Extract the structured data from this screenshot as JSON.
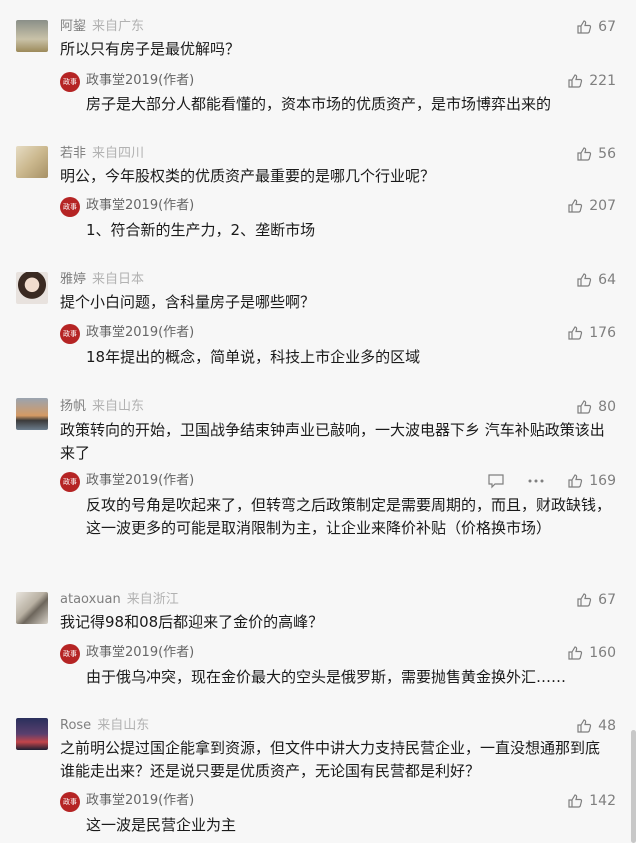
{
  "comments": [
    {
      "user": "阿鋆",
      "from": "来自广东",
      "likes": "67",
      "text": "所以只有房子是最优解吗？",
      "reply": {
        "author": "政事堂2019(作者)",
        "likes": "221",
        "text": "房子是大部分人都能看懂的，资本市场的优质资产，是市场博弈出来的"
      }
    },
    {
      "user": "若非",
      "from": "来自四川",
      "likes": "56",
      "text": "明公，今年股权类的优质资产最重要的是哪几个行业呢？",
      "reply": {
        "author": "政事堂2019(作者)",
        "likes": "207",
        "text": "1、符合新的生产力，2、垄断市场"
      }
    },
    {
      "user": "雅婷",
      "from": "来自日本",
      "likes": "64",
      "text": "提个小白问题，含科量房子是哪些啊？",
      "reply": {
        "author": "政事堂2019(作者)",
        "likes": "176",
        "text": "18年提出的概念，简单说，科技上市企业多的区域"
      }
    },
    {
      "user": "扬帆",
      "from": "来自山东",
      "likes": "80",
      "text": "政策转向的开始，卫国战争结束钟声业已敲响，一大波电器下乡 汽车补贴政策该出来了",
      "reply": {
        "author": "政事堂2019(作者)",
        "likes": "169",
        "text": "反攻的号角是吹起来了，但转弯之后政策制定是需要周期的，而且，财政缺钱，这一波更多的可能是取消限制为主，让企业来降价补贴（价格换市场）"
      }
    },
    {
      "user": "ataoxuan",
      "from": "来自浙江",
      "likes": "67",
      "text": "我记得98和08后都迎来了金价的高峰？",
      "reply": {
        "author": "政事堂2019(作者)",
        "likes": "160",
        "text": "由于俄乌冲突，现在金价最大的空头是俄罗斯，需要抛售黄金换外汇……"
      }
    },
    {
      "user": "Rose",
      "from": "来自山东",
      "likes": "48",
      "text": "之前明公提过国企能拿到资源，但文件中讲大力支持民营企业，一直没想通那到底谁能走出来？还是说只要是优质资产，无论国有民营都是利好？",
      "reply": {
        "author": "政事堂2019(作者)",
        "likes": "142",
        "text": "这一波是民营企业为主"
      }
    }
  ],
  "author_icon_text": "政事堂",
  "icons": {
    "like": "thumb-up-icon",
    "reply": "comment-icon",
    "more": "more-icon"
  }
}
